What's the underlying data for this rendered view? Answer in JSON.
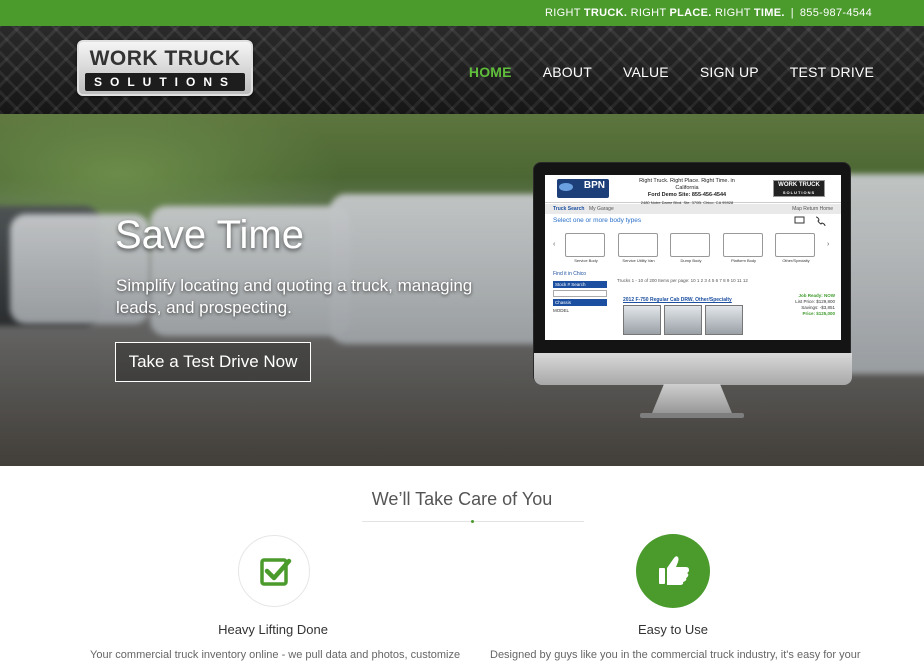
{
  "topbar": {
    "slogan_parts": [
      {
        "normal": "RIGHT ",
        "bold": "TRUCK."
      },
      {
        "normal": " RIGHT ",
        "bold": "PLACE."
      },
      {
        "normal": " RIGHT ",
        "bold": "TIME."
      }
    ],
    "separator": "|",
    "phone": "855-987-4544"
  },
  "logo": {
    "line1": "WORK TRUCK",
    "line2": "SOLUTIONS"
  },
  "nav": {
    "items": [
      {
        "label": "HOME",
        "active": true
      },
      {
        "label": "ABOUT",
        "active": false
      },
      {
        "label": "VALUE",
        "active": false
      },
      {
        "label": "SIGN UP",
        "active": false
      },
      {
        "label": "TEST DRIVE",
        "active": false
      }
    ]
  },
  "hero": {
    "title": "Save Time",
    "subtitle": "Simplify locating and quoting a truck, managing leads, and prospecting.",
    "cta": "Take a Test Drive Now"
  },
  "screen": {
    "brand": "BPN",
    "tagline": "Right Truck. Right Place. Right Time. in California",
    "site": "Ford Demo Site: 855-456-4544",
    "address": "2480 Notre Dame Blvd. Ste. 370B, Chico, CA 95928",
    "logo_line1": "WORK TRUCK",
    "logo_line2": "SOLUTIONS",
    "tabs": {
      "left": "Truck Search",
      "middle": "My Garage",
      "right": "Map   Return Home"
    },
    "select_label": "Select one or more body types",
    "body_types": [
      "Service Body",
      "Service Utility Van",
      "Dump Body",
      "Platform Body",
      "Other/Specialty"
    ],
    "find_label": "Find it in Chico",
    "side_headers": [
      "Stock # Search",
      "Chassis"
    ],
    "side_model": "MODEL",
    "pagination": "Trucks 1 - 10 of 200        Items per page: 10        1 2 3 4 5 6 7 8 9 10 11 12",
    "listing_title": "2012 F-750 Regular Cab DRW, Other/Specialty",
    "price_lines": [
      "Job Ready: NOW",
      "List Price: $129,800",
      "Savings: -$3,851",
      "Price: $125,000"
    ]
  },
  "section": {
    "title": "We’ll Take Care of You"
  },
  "features": [
    {
      "icon": "check-icon",
      "title": "Heavy Lifting Done",
      "body": "Your commercial truck inventory online - we pull data and photos, customize"
    },
    {
      "icon": "thumbs-up-icon",
      "title": "Easy to Use",
      "body": "Designed by guys like you in the commercial truck industry, it's easy for your"
    }
  ],
  "colors": {
    "accent": "#4a9a2c",
    "nav_active": "#5fbf3a",
    "screen_blue": "#1c4fa0"
  }
}
